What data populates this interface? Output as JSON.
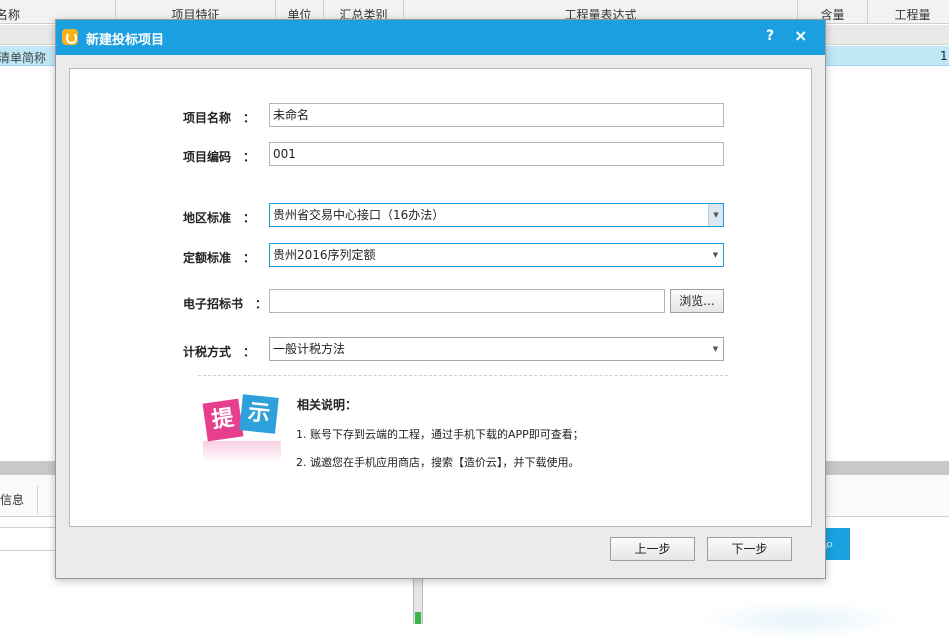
{
  "background": {
    "columns": [
      "名称",
      "项目特征",
      "单位",
      "汇总类别",
      "工程量表达式",
      "含量",
      "工程量"
    ],
    "row2_text": "清单简称",
    "row2_value": "1",
    "tab_label": "信息"
  },
  "dialog": {
    "title": "新建投标项目",
    "help": "?",
    "close": "×",
    "fields": {
      "project_name": {
        "label": "项目名称",
        "colon": "：",
        "value": "未命名"
      },
      "project_code": {
        "label": "项目编码",
        "colon": "：",
        "value": "001"
      },
      "region_standard": {
        "label": "地区标准",
        "colon": "：",
        "value": "贵州省交易中心接口（16办法）"
      },
      "quota_standard": {
        "label": "定额标准",
        "colon": "：",
        "value": "贵州2016序列定额"
      },
      "e_tender": {
        "label": "电子招标书",
        "colon": "：",
        "value": "",
        "browse": "浏览..."
      },
      "tax_method": {
        "label": "计税方式",
        "colon": "：",
        "value": "一般计税方法"
      }
    },
    "tip": {
      "card1": "提",
      "card2": "示",
      "title": "相关说明：",
      "lines": [
        "1.  账号下存到云端的工程，通过手机下载的APP即可查看；",
        "2.  诚邀您在手机应用商店，搜索【造价云】，并下载使用。"
      ]
    },
    "buttons": {
      "prev": "上一步",
      "next": "下一步"
    }
  },
  "colors": {
    "accent": "#1a9fe0",
    "tip_pink": "#e53f8e",
    "tip_blue": "#2ea0dc",
    "selected_row": "#bfe8f7"
  }
}
